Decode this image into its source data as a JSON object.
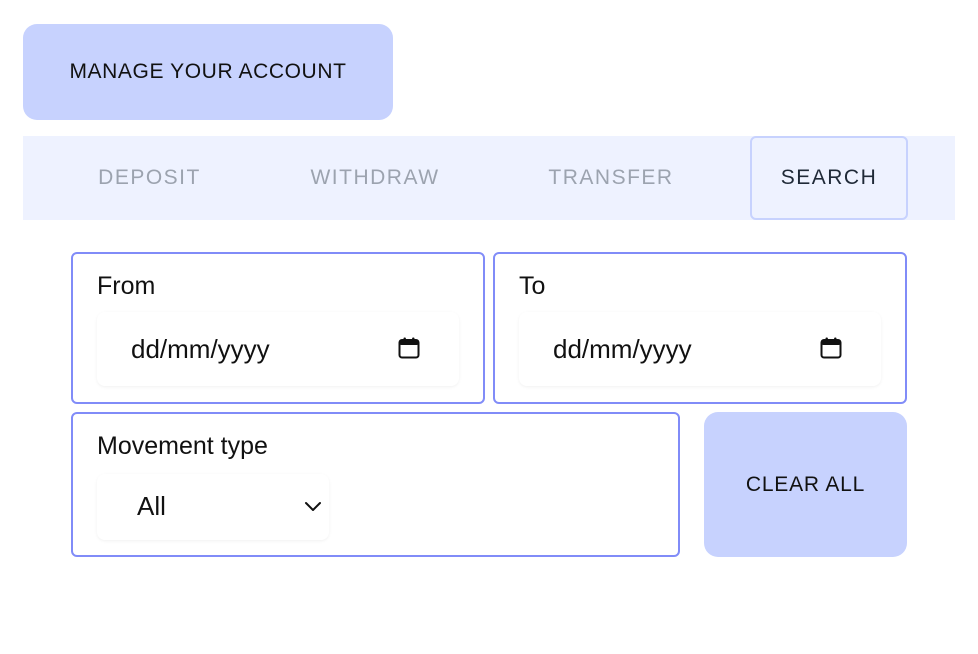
{
  "header": {
    "manage_account_label": "MANAGE YOUR ACCOUNT"
  },
  "tabs": [
    {
      "label": "DEPOSIT",
      "active": false
    },
    {
      "label": "WITHDRAW",
      "active": false
    },
    {
      "label": "TRANSFER",
      "active": false
    },
    {
      "label": "SEARCH",
      "active": true
    }
  ],
  "search": {
    "from": {
      "label": "From",
      "placeholder": "dd/mm/yyyy",
      "icon": "calendar-icon"
    },
    "to": {
      "label": "To",
      "placeholder": "dd/mm/yyyy",
      "icon": "calendar-icon"
    },
    "movement_type": {
      "label": "Movement type",
      "value": "All",
      "icon": "chevron-down-icon"
    },
    "clear_label": "CLEAR ALL"
  },
  "colors": {
    "button_bg": "#c7d2fe",
    "tab_bar_bg": "#eef2ff",
    "field_border": "#818cf8",
    "tab_inactive_text": "#9ca3af",
    "tab_active_text": "#1f2937"
  }
}
